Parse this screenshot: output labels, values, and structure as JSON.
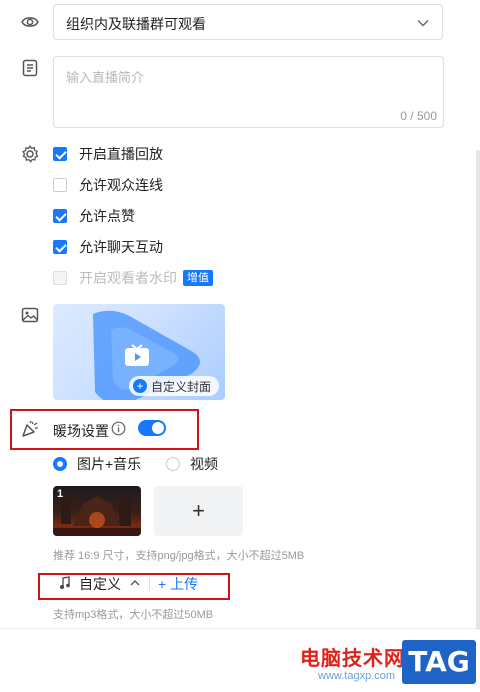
{
  "visibility": {
    "icon": "eye-icon",
    "value": "组织内及联播群可观看"
  },
  "intro": {
    "icon": "document-icon",
    "placeholder": "输入直播简介",
    "counter": "0 / 500"
  },
  "settings": {
    "icon": "gear-icon",
    "options": [
      {
        "label": "开启直播回放",
        "checked": true
      },
      {
        "label": "允许观众连线",
        "checked": false
      },
      {
        "label": "允许点赞",
        "checked": true
      },
      {
        "label": "允许聊天互动",
        "checked": true
      },
      {
        "label": "开启观看者水印",
        "checked": false,
        "disabled": true,
        "badge": "增值"
      }
    ]
  },
  "cover": {
    "icon": "image-icon",
    "button_label": "自定义封面"
  },
  "warmup": {
    "icon": "party-popper-icon",
    "title": "暖场设置",
    "info_icon": "info-icon",
    "enabled": true,
    "radio_options": [
      {
        "label": "图片+音乐",
        "selected": true
      },
      {
        "label": "视频",
        "selected": false
      }
    ],
    "thumb_index": "1",
    "add_label": "+",
    "image_hint": "推荐 16:9 尺寸，支持png/jpg格式，大小不超过5MB",
    "music": {
      "icon": "music-note-icon",
      "selected": "自定义",
      "upload_label": "+ 上传",
      "hint": "支持mp3格式，大小不超过50MB"
    }
  },
  "watermark": {
    "site_name": "电脑技术网",
    "url": "www.tagxp.com",
    "tag": "TAG"
  },
  "colors": {
    "accent": "#1677ff",
    "highlight": "#d0121b"
  }
}
